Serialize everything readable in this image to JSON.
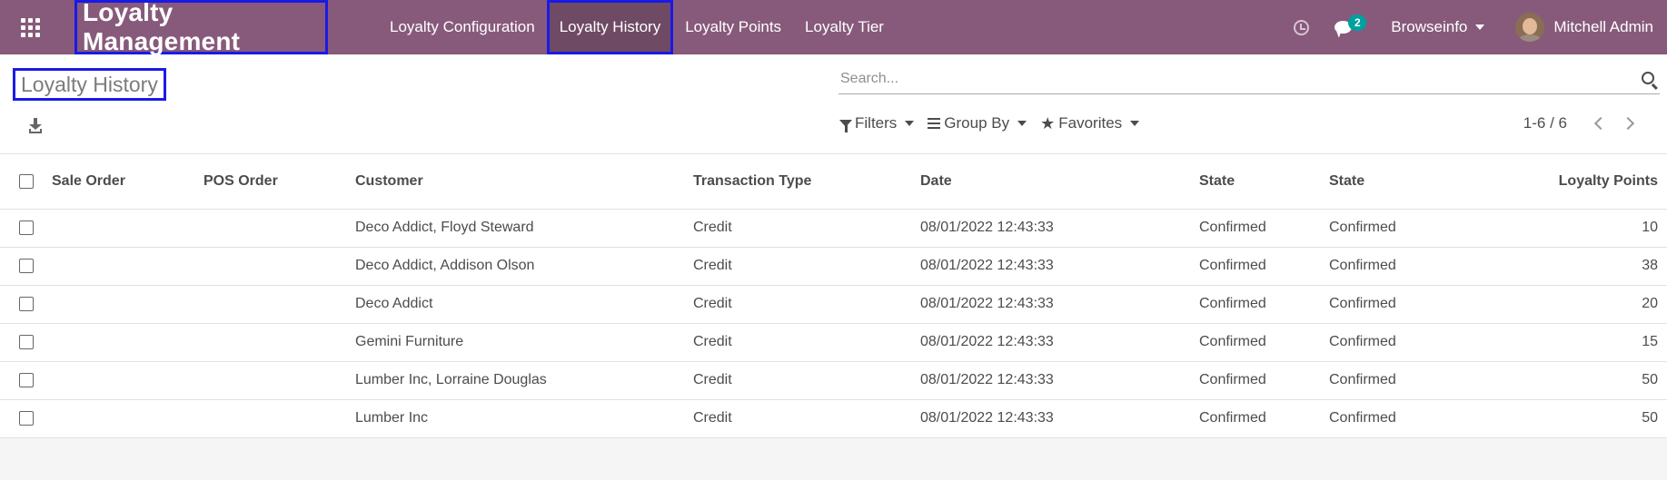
{
  "navbar": {
    "app_title": "Loyalty Management",
    "menu": [
      {
        "label": "Loyalty Configuration"
      },
      {
        "label": "Loyalty History"
      },
      {
        "label": "Loyalty Points"
      },
      {
        "label": "Loyalty Tier"
      }
    ],
    "chat_count": "2",
    "company": "Browseinfo",
    "user": "Mitchell Admin"
  },
  "control_panel": {
    "page_title": "Loyalty History",
    "search_placeholder": "Search...",
    "filters_label": "Filters",
    "groupby_label": "Group By",
    "favorites_label": "Favorites",
    "pager": "1-6 / 6"
  },
  "table": {
    "headers": [
      "Sale Order",
      "POS Order",
      "Customer",
      "Transaction Type",
      "Date",
      "State",
      "State",
      "Loyalty Points"
    ],
    "rows": [
      {
        "sale_order": "",
        "pos_order": "",
        "customer": "Deco Addict, Floyd Steward",
        "type": "Credit",
        "date": "08/01/2022 12:43:33",
        "state1": "Confirmed",
        "state2": "Confirmed",
        "points": "10"
      },
      {
        "sale_order": "",
        "pos_order": "",
        "customer": "Deco Addict, Addison Olson",
        "type": "Credit",
        "date": "08/01/2022 12:43:33",
        "state1": "Confirmed",
        "state2": "Confirmed",
        "points": "38"
      },
      {
        "sale_order": "",
        "pos_order": "",
        "customer": "Deco Addict",
        "type": "Credit",
        "date": "08/01/2022 12:43:33",
        "state1": "Confirmed",
        "state2": "Confirmed",
        "points": "20"
      },
      {
        "sale_order": "",
        "pos_order": "",
        "customer": "Gemini Furniture",
        "type": "Credit",
        "date": "08/01/2022 12:43:33",
        "state1": "Confirmed",
        "state2": "Confirmed",
        "points": "15"
      },
      {
        "sale_order": "",
        "pos_order": "",
        "customer": "Lumber Inc, Lorraine Douglas",
        "type": "Credit",
        "date": "08/01/2022 12:43:33",
        "state1": "Confirmed",
        "state2": "Confirmed",
        "points": "50"
      },
      {
        "sale_order": "",
        "pos_order": "",
        "customer": "Lumber Inc",
        "type": "Credit",
        "date": "08/01/2022 12:43:33",
        "state1": "Confirmed",
        "state2": "Confirmed",
        "points": "50"
      }
    ]
  }
}
